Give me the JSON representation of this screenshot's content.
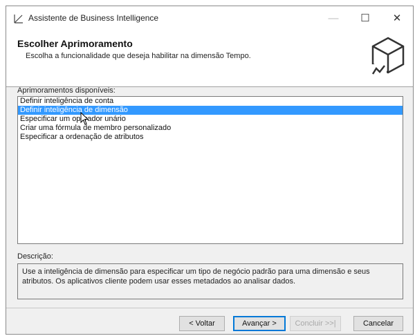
{
  "window": {
    "title": "Assistente de Business Intelligence",
    "controls": {
      "minimize": "—",
      "maximize": "☐",
      "close": "✕"
    }
  },
  "header": {
    "title": "Escolher Aprimoramento",
    "subtitle": "Escolha a funcionalidade que deseja habilitar na dimensão Tempo."
  },
  "enhancements": {
    "label": "Aprimoramentos disponíveis:",
    "items": [
      "Definir inteligência de conta",
      "Definir inteligência de dimensão",
      "Especificar um operador unário",
      "Criar uma fórmula de membro personalizado",
      "Especificar a ordenação de atributos"
    ],
    "selected_index": 1
  },
  "description": {
    "label": "Descrição:",
    "text": "Use a inteligência de dimensão para especificar um tipo de negócio padrão para uma dimensão e seus atributos. Os aplicativos cliente podem usar esses metadados ao analisar dados."
  },
  "buttons": {
    "back": "< Voltar",
    "next": "Avançar >",
    "finish": "Concluir >>|",
    "cancel": "Cancelar"
  },
  "colors": {
    "selection": "#3399ff",
    "default_button_border": "#0078d7"
  }
}
